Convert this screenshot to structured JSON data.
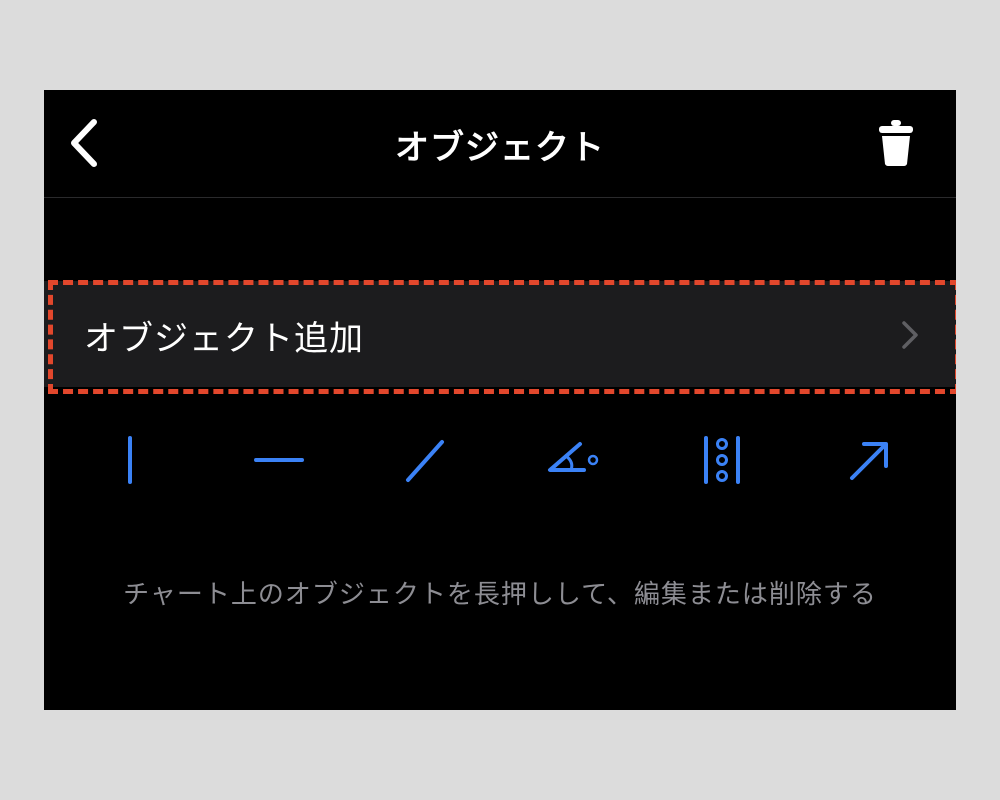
{
  "navbar": {
    "title": "オブジェクト",
    "back_icon": "chevron-left-icon",
    "trash_icon": "trash-icon"
  },
  "add_object": {
    "label": "オブジェクト追加",
    "chevron_icon": "chevron-right-icon"
  },
  "tools": [
    {
      "name": "vertical-line-tool-icon"
    },
    {
      "name": "horizontal-line-tool-icon"
    },
    {
      "name": "trend-line-tool-icon"
    },
    {
      "name": "angle-tool-icon"
    },
    {
      "name": "vertical-dots-tool-icon"
    },
    {
      "name": "arrow-tool-icon"
    }
  ],
  "hint": "チャート上のオブジェクトを長押しして、編集または削除する",
  "colors": {
    "accent": "#3b82f6",
    "highlight": "#e2472c",
    "background": "#000000",
    "row_background": "#1c1c1e",
    "hint_text": "#8d8d93"
  }
}
